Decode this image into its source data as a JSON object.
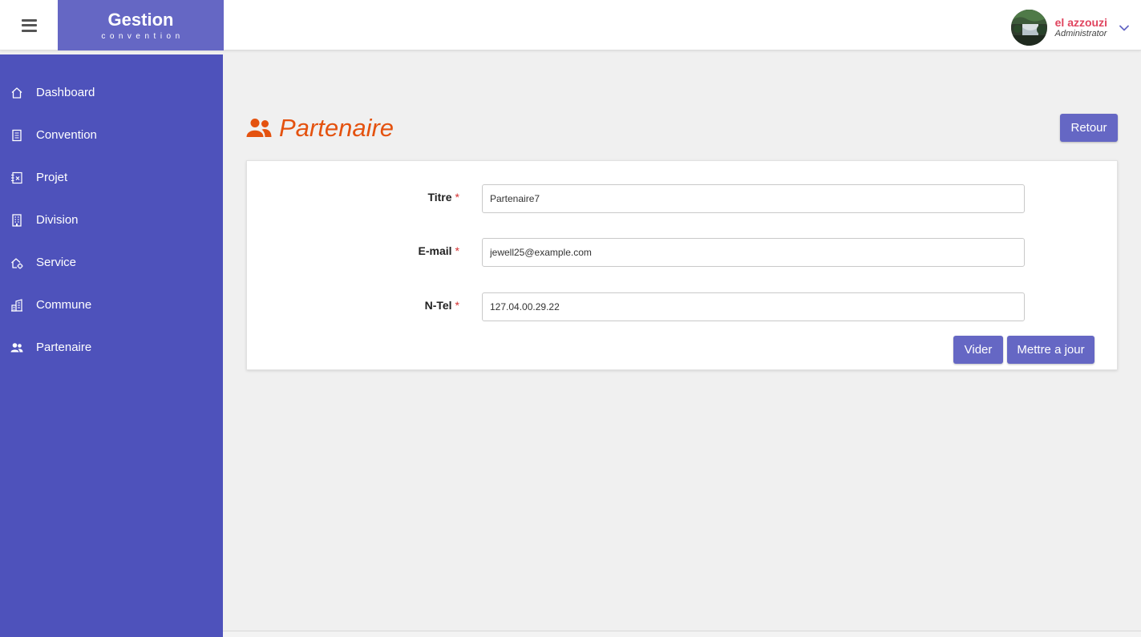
{
  "app": {
    "brand_title": "Gestion",
    "brand_subtitle": "convention"
  },
  "user": {
    "name": "el azzouzi",
    "role": "Administrator"
  },
  "sidebar": {
    "items": [
      {
        "label": "Dashboard",
        "icon": "home-icon"
      },
      {
        "label": "Convention",
        "icon": "document-icon"
      },
      {
        "label": "Projet",
        "icon": "project-icon"
      },
      {
        "label": "Division",
        "icon": "building-icon"
      },
      {
        "label": "Service",
        "icon": "service-icon"
      },
      {
        "label": "Commune",
        "icon": "city-icon"
      },
      {
        "label": "Partenaire",
        "icon": "users-icon"
      }
    ]
  },
  "page": {
    "title": "Partenaire",
    "title_icon": "users-icon",
    "back_label": "Retour"
  },
  "form": {
    "titre": {
      "label": "Titre",
      "required": "*",
      "value": "Partenaire7"
    },
    "email": {
      "label": "E-mail",
      "required": "*",
      "value": "jewell25@example.com"
    },
    "ntel": {
      "label": "N-Tel",
      "required": "*",
      "value": "127.04.00.29.22"
    },
    "clear_label": "Vider",
    "update_label": "Mettre a jour"
  },
  "colors": {
    "sidebar_bg": "#4e52bb",
    "brand_bg": "#6567c4",
    "button_bg": "#6567c4",
    "title_color": "#e4520f",
    "username_color": "#e0455f",
    "required_color": "#d32f2f"
  }
}
